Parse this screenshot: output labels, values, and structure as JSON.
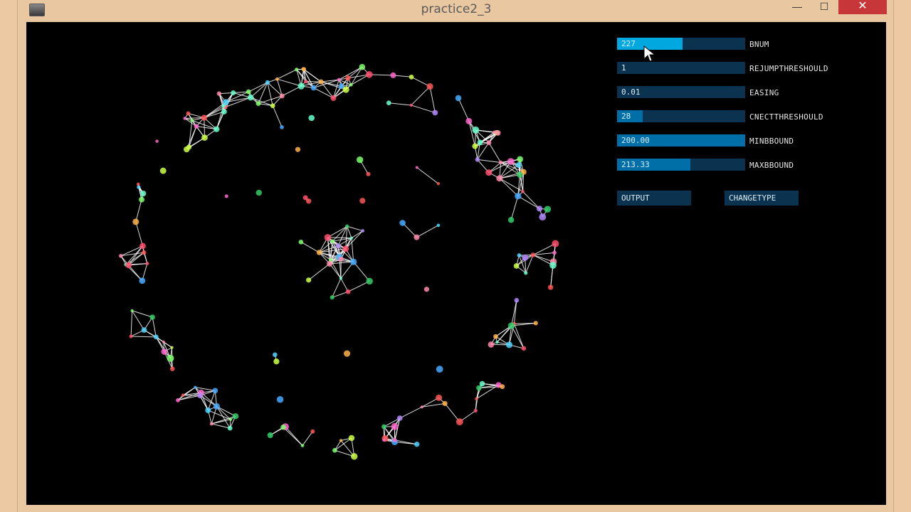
{
  "window": {
    "title": "practice2_3",
    "minimize": "—",
    "maximize": "☐",
    "close": "✕"
  },
  "controls": {
    "sliders": [
      {
        "id": "bnum",
        "value": "227",
        "label": "BNUM",
        "fraction": 0.51,
        "active": true
      },
      {
        "id": "rejump",
        "value": "1",
        "label": "REJUMPTHRESHOULD",
        "fraction": 0.0,
        "active": false
      },
      {
        "id": "easing",
        "value": "0.01",
        "label": "EASING",
        "fraction": 0.0,
        "active": false
      },
      {
        "id": "cnect",
        "value": "28",
        "label": "CNECTTHRESHOULD",
        "fraction": 0.2,
        "active": false
      },
      {
        "id": "minbbound",
        "value": "200.00",
        "label": "MINBBOUND",
        "fraction": 1.0,
        "active": false
      },
      {
        "id": "maxbbound",
        "value": "213.33",
        "label": "MAXBBOUND",
        "fraction": 0.57,
        "active": false
      }
    ],
    "buttons": {
      "output": "OUTPUT",
      "changetype": "CHANGETYPE"
    }
  },
  "colors": {
    "slider_bg": "#0b3350",
    "slider_fill": "#006fa8",
    "slider_fill_active": "#00a8e0",
    "canvas_bg": "#000000",
    "links": "#ffffff"
  }
}
